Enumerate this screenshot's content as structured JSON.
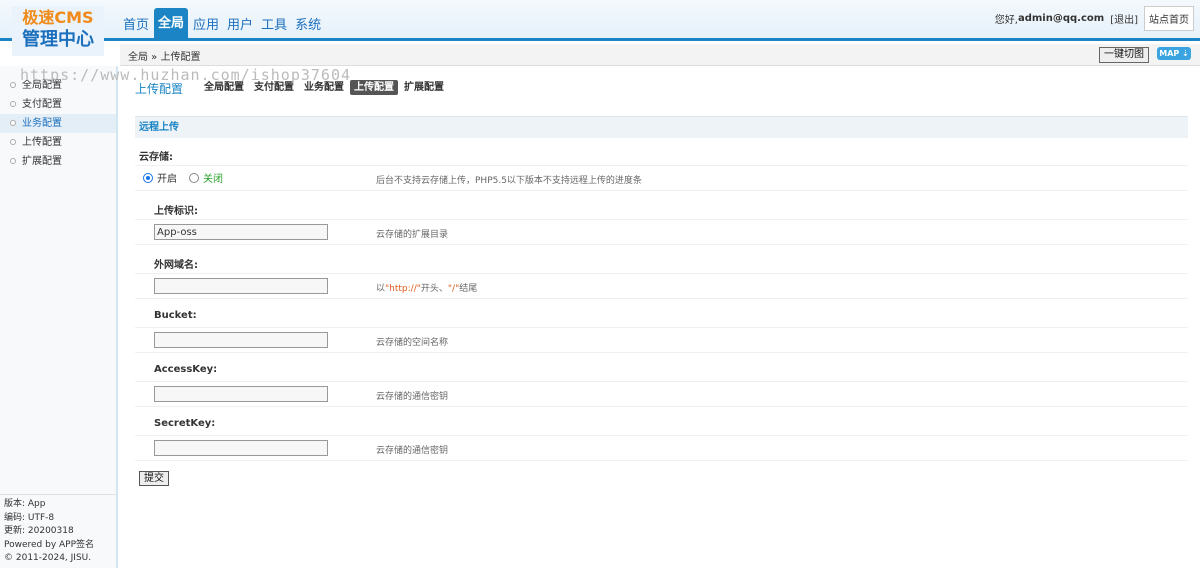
{
  "logo": {
    "line1": "极速CMS",
    "line2": "管理中心"
  },
  "topnav": [
    {
      "label": "首页",
      "active": false
    },
    {
      "label": "全局",
      "active": true
    },
    {
      "label": "应用",
      "active": false
    },
    {
      "label": "用户",
      "active": false
    },
    {
      "label": "工具",
      "active": false
    },
    {
      "label": "系统",
      "active": false
    }
  ],
  "user": {
    "greeting": "您好,",
    "name": "admin@qq.com",
    "logout": "[退出]",
    "home": "站点首页"
  },
  "breadcrumb": "全局 » 上传配置",
  "toolbar": {
    "switch_label": "一键切图",
    "map_label": "MAP ⇣"
  },
  "watermark": "https://www.huzhan.com/ishop37604",
  "sidebar": {
    "items": [
      "全局配置",
      "支付配置",
      "业务配置",
      "上传配置",
      "扩展配置"
    ],
    "active_index": 2,
    "footer": [
      "版本: App",
      "编码: UTF-8",
      "更新: 20200318",
      "Powered by APP签名",
      "© 2011-2024, JISU."
    ]
  },
  "main": {
    "title": "上传配置",
    "subtabs": [
      "全局配置",
      "支付配置",
      "业务配置",
      "上传配置",
      "扩展配置"
    ],
    "active_subtab": 3,
    "section": "远程上传",
    "cloud": {
      "label": "云存储:",
      "on_label": "开启",
      "off_label": "关闭",
      "selected": "开启",
      "desc": "后台不支持云存储上传，PHP5.5以下版本不支持远程上传的进度条"
    },
    "fields": [
      {
        "label": "上传标识:",
        "value": "App-oss",
        "desc": "云存储的扩展目录"
      },
      {
        "label": "外网域名:",
        "value": "",
        "desc_pre": "以",
        "desc_hl1": "\"http://\"",
        "desc_mid": "开头、",
        "desc_hl2": "\"/\"",
        "desc_post": "结尾"
      },
      {
        "label": "Bucket:",
        "value": "",
        "desc": "云存储的空间名称"
      },
      {
        "label": "AccessKey:",
        "value": "",
        "desc": "云存储的通信密钥"
      },
      {
        "label": "SecretKey:",
        "value": "",
        "desc": "云存储的通信密钥"
      }
    ],
    "submit": "提交"
  }
}
